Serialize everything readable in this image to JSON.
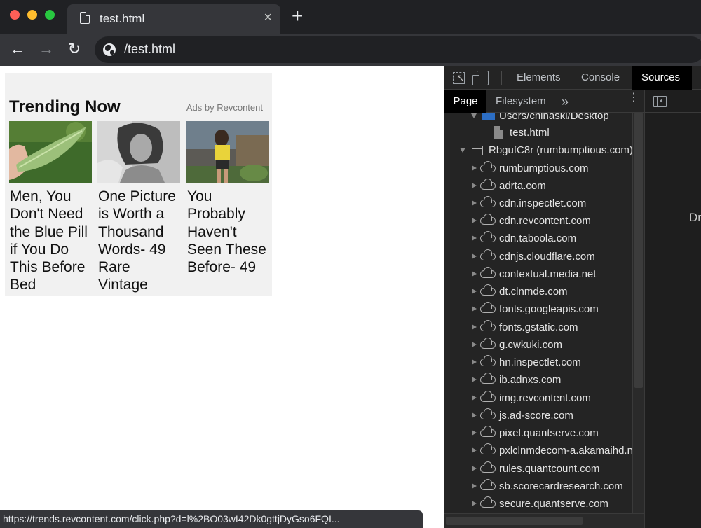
{
  "tab": {
    "title": "test.html",
    "close_glyph": "×",
    "new_tab_glyph": "+"
  },
  "toolbar": {
    "back": "←",
    "forward": "→",
    "reload": "↻",
    "url": "/test.html"
  },
  "ad": {
    "title": "Trending Now",
    "attribution": "Ads by Revcontent",
    "cards": [
      {
        "headline": "Men, You Don't Need the Blue Pill if You Do This Before Bed",
        "image": "aloe-leaf-photo"
      },
      {
        "headline": "One Picture is Worth a Thousand Words- 49 Rare Vintage",
        "image": "vintage-portrait-photo"
      },
      {
        "headline": "You Probably Haven't Seen These Before- 49",
        "image": "woman-outdoors-photo"
      }
    ]
  },
  "status_bar": {
    "url": "https://trends.revcontent.com/click.php?d=l%2BO03wI42Dk0gttjDyGso6FQI..."
  },
  "devtools": {
    "tabs": {
      "elements": "Elements",
      "console": "Console",
      "sources": "Sources"
    },
    "subtabs": {
      "page": "Page",
      "filesystem": "Filesystem",
      "more": "»",
      "menu": "⋮"
    },
    "right_pane_text": "Dr",
    "tree": {
      "folder": "Users/chinaski/Desktop",
      "file": "test.html",
      "frame": "RbgufC8r (rumbumptious.com)",
      "domains": [
        "rumbumptious.com",
        "adrta.com",
        "cdn.inspectlet.com",
        "cdn.revcontent.com",
        "cdn.taboola.com",
        "cdnjs.cloudflare.com",
        "contextual.media.net",
        "dt.clnmde.com",
        "fonts.googleapis.com",
        "fonts.gstatic.com",
        "g.cwkuki.com",
        "hn.inspectlet.com",
        "ib.adnxs.com",
        "img.revcontent.com",
        "js.ad-score.com",
        "pixel.quantserve.com",
        "pxlclnmdecom-a.akamaihd.net",
        "rules.quantcount.com",
        "sb.scorecardresearch.com",
        "secure.quantserve.com"
      ]
    }
  }
}
